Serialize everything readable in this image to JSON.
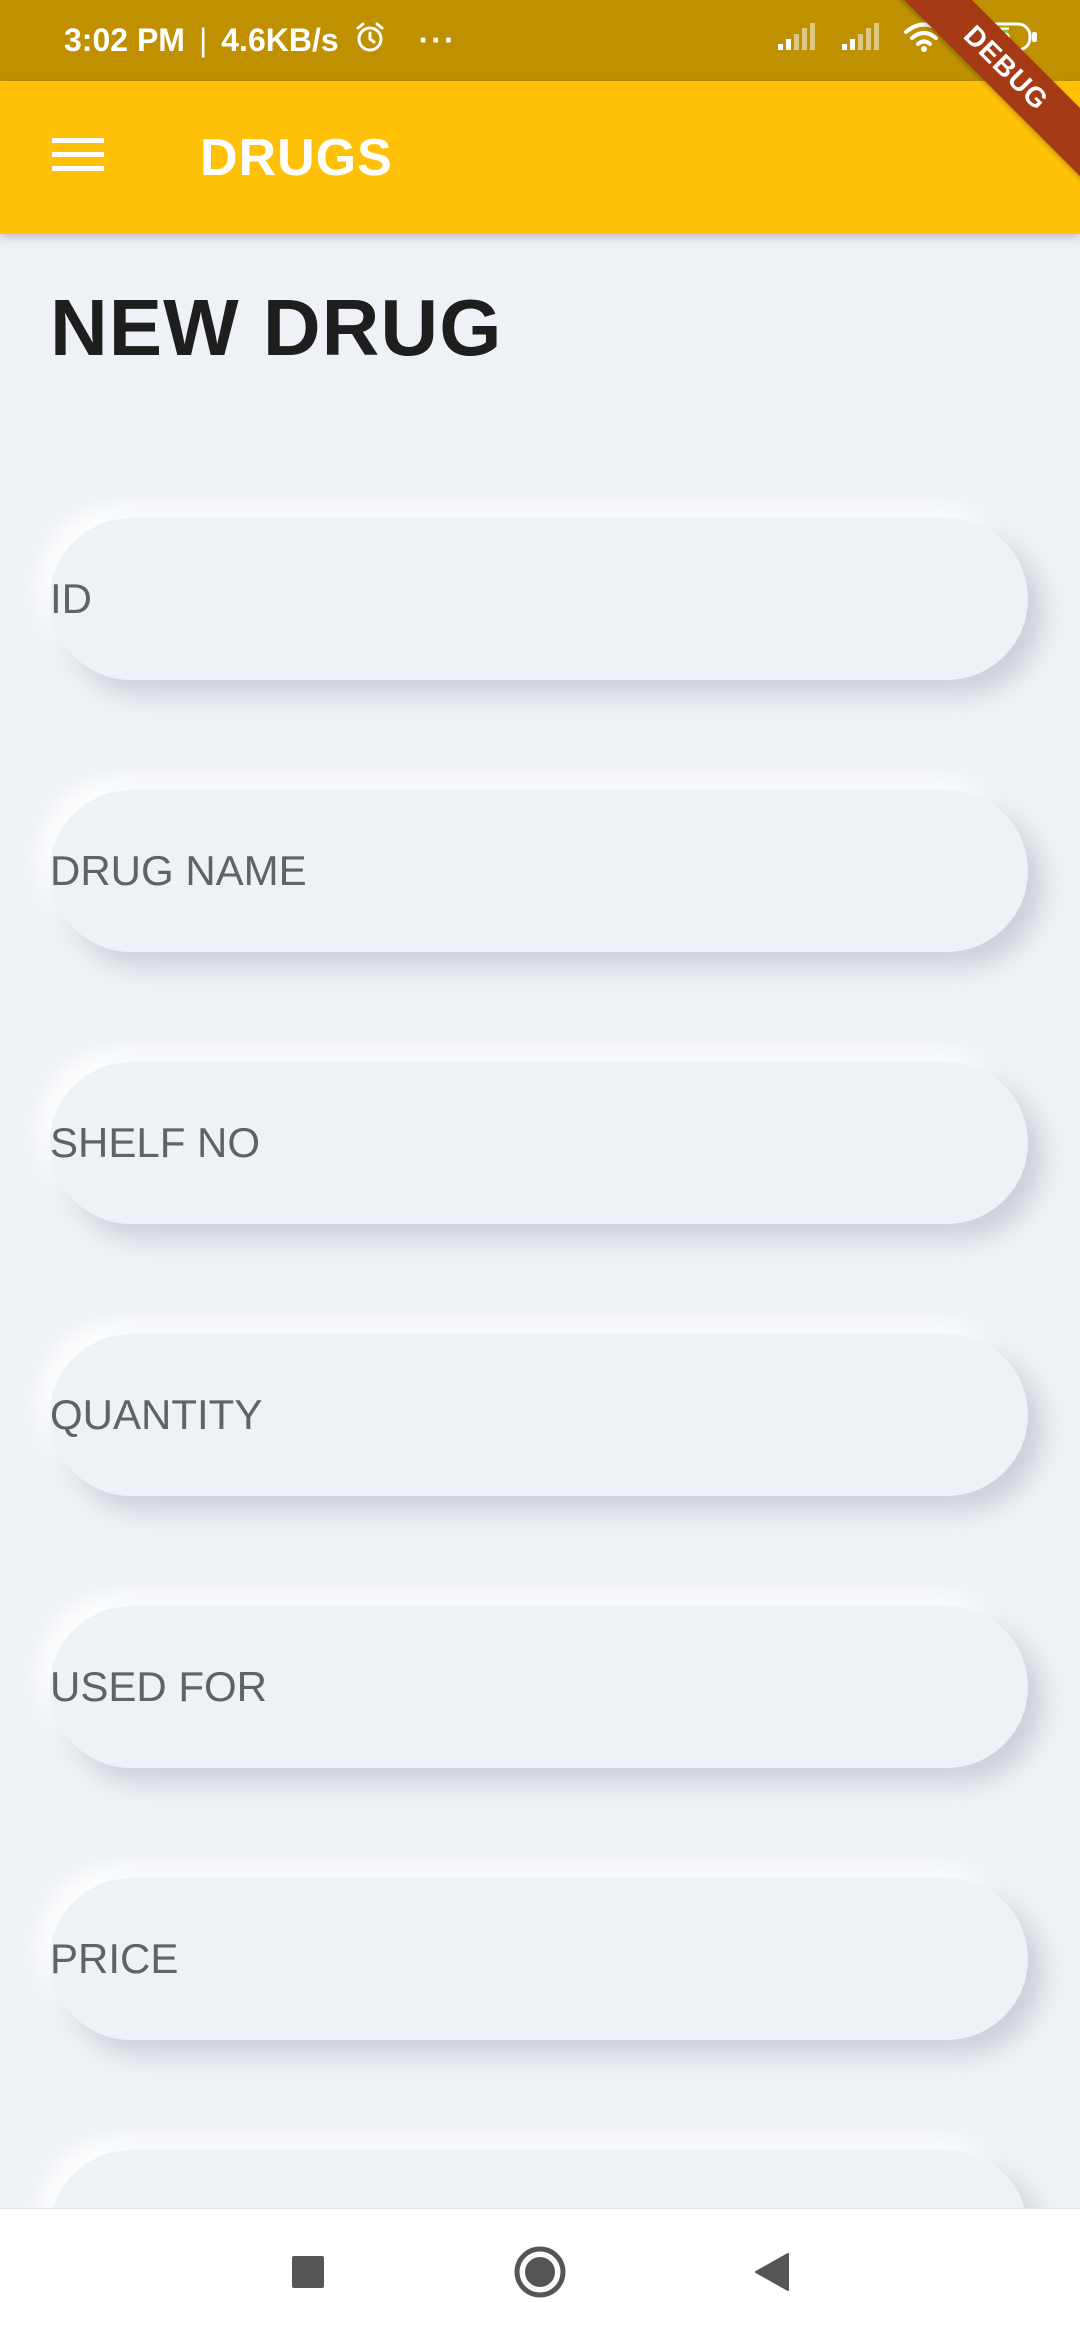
{
  "status_bar": {
    "time": "3:02 PM",
    "separator": "|",
    "speed": "4.6KB/s",
    "more": "···",
    "battery": "65"
  },
  "app_bar": {
    "title": "DRUGS"
  },
  "debug_banner": {
    "label": "DEBUG"
  },
  "page": {
    "title": "NEW DRUG"
  },
  "form": {
    "fields": [
      {
        "placeholder": "ID",
        "value": ""
      },
      {
        "placeholder": "DRUG NAME",
        "value": ""
      },
      {
        "placeholder": "SHELF NO",
        "value": ""
      },
      {
        "placeholder": "QUANTITY",
        "value": ""
      },
      {
        "placeholder": "USED FOR",
        "value": ""
      },
      {
        "placeholder": "PRICE",
        "value": ""
      },
      {
        "placeholder": "",
        "value": ""
      }
    ]
  },
  "colors": {
    "app_bar": "#FFC107",
    "status_bar": "#BF9000",
    "background": "#EEF1F5",
    "debug": "#A63A14"
  }
}
